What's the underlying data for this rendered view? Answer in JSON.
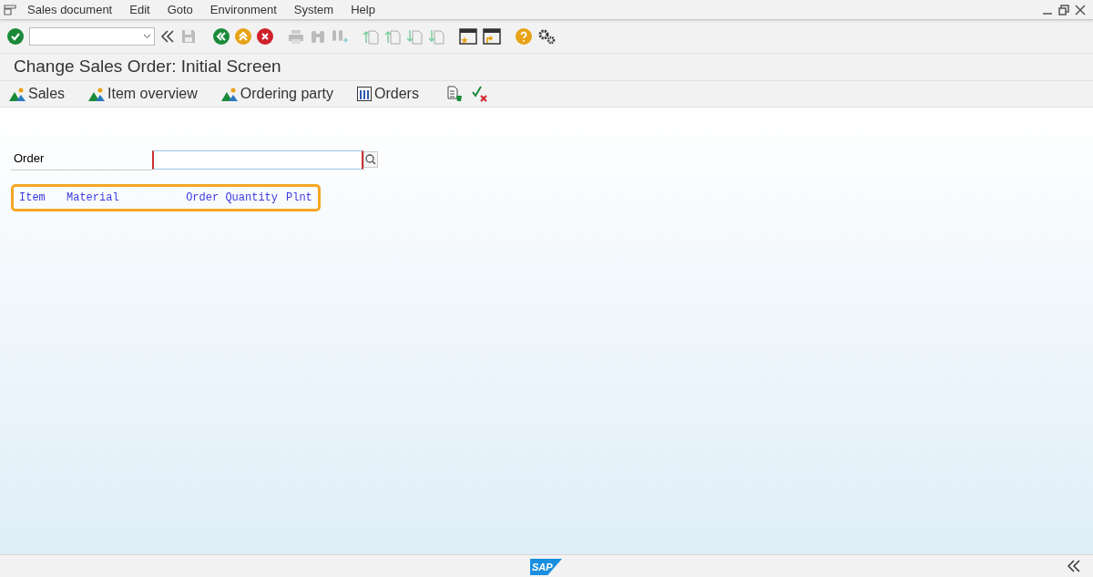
{
  "menu_bar": {
    "items": [
      "Sales document",
      "Edit",
      "Goto",
      "Environment",
      "System",
      "Help"
    ]
  },
  "title": "Change Sales Order: Initial Screen",
  "app_toolbar": {
    "items": [
      {
        "label": "Sales",
        "kind": "mountain"
      },
      {
        "label": "Item overview",
        "kind": "mountain"
      },
      {
        "label": "Ordering party",
        "kind": "mountain"
      },
      {
        "label": "Orders",
        "kind": "columns"
      }
    ]
  },
  "form": {
    "order_label": "Order"
  },
  "item_header": {
    "columns": [
      "Item",
      "Material",
      "Order Quantity",
      "Plnt"
    ]
  },
  "footer": {
    "logo": "SAP"
  }
}
